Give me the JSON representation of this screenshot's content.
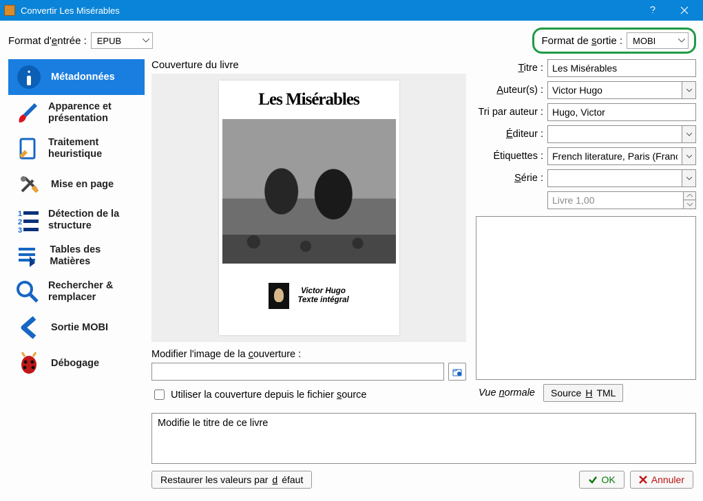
{
  "window": {
    "title": "Convertir Les Misérables"
  },
  "input_format": {
    "label_pre": "Format d'",
    "label_u": "e",
    "label_post": "ntrée :",
    "value": "EPUB"
  },
  "output_format": {
    "label_pre": "Format de ",
    "label_u": "s",
    "label_post": "ortie :",
    "value": "MOBI"
  },
  "sidebar": {
    "items": [
      {
        "label": "Métadonnées"
      },
      {
        "label": "Apparence et présentation"
      },
      {
        "label": "Traitement heuristique"
      },
      {
        "label": "Mise en page"
      },
      {
        "label": "Détection de la structure"
      },
      {
        "label": "Tables des Matières"
      },
      {
        "label": "Rechercher & remplacer"
      },
      {
        "label": "Sortie MOBI"
      },
      {
        "label": "Débogage"
      }
    ]
  },
  "cover": {
    "section_label": "Couverture du livre",
    "book_title": "Les Misérables",
    "author_line1": "Victor Hugo",
    "author_line2": "Texte intégral",
    "modify_label_pre": "Modifier l'image de la ",
    "modify_label_u": "c",
    "modify_label_post": "ouverture :",
    "modify_value": "",
    "use_source_pre": "Utiliser la couverture depuis le fichier ",
    "use_source_u": "s",
    "use_source_post": "ource"
  },
  "meta": {
    "title": {
      "label_u": "T",
      "label_post": "itre :",
      "value": "Les Misérables"
    },
    "authors": {
      "label_u": "A",
      "label_post": "uteur(s) :",
      "value": "Victor Hugo"
    },
    "author_sort": {
      "label": "Tri par auteur :",
      "value": "Hugo, Victor"
    },
    "publisher": {
      "label_u": "É",
      "label_post": "diteur :",
      "value": ""
    },
    "tags": {
      "label": "Étiquettes :",
      "value": "French literature, Paris (France)"
    },
    "series": {
      "label_u": "S",
      "label_post": "érie :",
      "value": ""
    },
    "series_index": {
      "value": "Livre 1,00"
    }
  },
  "view_tabs": {
    "normal_pre": "Vue ",
    "normal_u": "n",
    "normal_post": "ormale",
    "html_pre": "Source ",
    "html_u": "H",
    "html_post": "TML"
  },
  "tooltip": "Modifie le titre de ce livre",
  "buttons": {
    "restore_pre": "Restaurer les valeurs par ",
    "restore_u": "d",
    "restore_post": "éfaut",
    "ok": "OK",
    "cancel": "Annuler"
  }
}
